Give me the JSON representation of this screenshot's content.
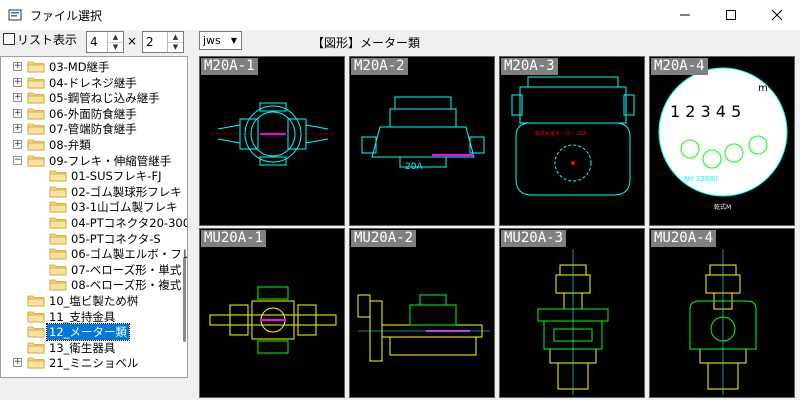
{
  "window": {
    "title": "ファイル選択",
    "controls": {
      "minimize": "—",
      "maximize": "☐",
      "close": "✕"
    }
  },
  "toolbar": {
    "list_display_label": "リスト表示",
    "list_display_checked": false,
    "columns_value": "4",
    "times_sign": "×",
    "rows_value": "2",
    "filetype_value": "jws",
    "section_title": "【図形】メーター類"
  },
  "tree": {
    "items": [
      {
        "label": "03-MD継手",
        "expander": "+",
        "level": 0
      },
      {
        "label": "04-ドレネジ継手",
        "expander": "+",
        "level": 0
      },
      {
        "label": "05-鋼管ねじ込み継手",
        "expander": "+",
        "level": 0
      },
      {
        "label": "06-外面防食継手",
        "expander": "+",
        "level": 0
      },
      {
        "label": "07-管端防食継手",
        "expander": "+",
        "level": 0
      },
      {
        "label": "08-弁類",
        "expander": "+",
        "level": 0
      },
      {
        "label": "09-フレキ・伸縮管継手",
        "expander": "−",
        "level": 0
      },
      {
        "label": "01-SUSフレキ-FJ",
        "expander": "",
        "level": 1
      },
      {
        "label": "02-ゴム製球形フレキ",
        "expander": "",
        "level": 1
      },
      {
        "label": "03-1山ゴム製フレキ",
        "expander": "",
        "level": 1
      },
      {
        "label": "04-PTコネクタ20-300",
        "expander": "",
        "level": 1
      },
      {
        "label": "05-PTコネクタ-S",
        "expander": "",
        "level": 1
      },
      {
        "label": "06-ゴム製エルボ・フレ",
        "expander": "",
        "level": 1
      },
      {
        "label": "07-ベローズ形・単式",
        "expander": "",
        "level": 1
      },
      {
        "label": "08-ベローズ形・複式",
        "expander": "",
        "level": 1
      },
      {
        "label": "10_塩ビ製ため桝",
        "expander": "",
        "level": 0
      },
      {
        "label": "11_支持金具",
        "expander": "",
        "level": 0
      },
      {
        "label": "12_メーター類",
        "expander": "",
        "level": 0,
        "selected": true
      },
      {
        "label": "13_衛生器具",
        "expander": "",
        "level": 0
      },
      {
        "label": "21_ミニショベル",
        "expander": "+",
        "level": 0
      }
    ]
  },
  "thumbnails": [
    {
      "label": "M20A-1"
    },
    {
      "label": "M20A-2"
    },
    {
      "label": "M20A-3",
      "caption": "乾式水道メーター 20A"
    },
    {
      "label": "M20A-4",
      "dial_digits": "1 2 3 4 5",
      "unit": "m³",
      "serial": "No 22600",
      "footer": "乾式M"
    },
    {
      "label": "MU20A-1"
    },
    {
      "label": "MU20A-2"
    },
    {
      "label": "MU20A-3"
    },
    {
      "label": "MU20A-4"
    }
  ],
  "colors": {
    "thumb_bg": "#000000",
    "cyan": "#00ffff",
    "yellow": "#ffff00",
    "green": "#00ff00",
    "magenta": "#ff00ff",
    "red": "#ff0000",
    "selection": "#0078d7",
    "folder": "#f8d775"
  }
}
